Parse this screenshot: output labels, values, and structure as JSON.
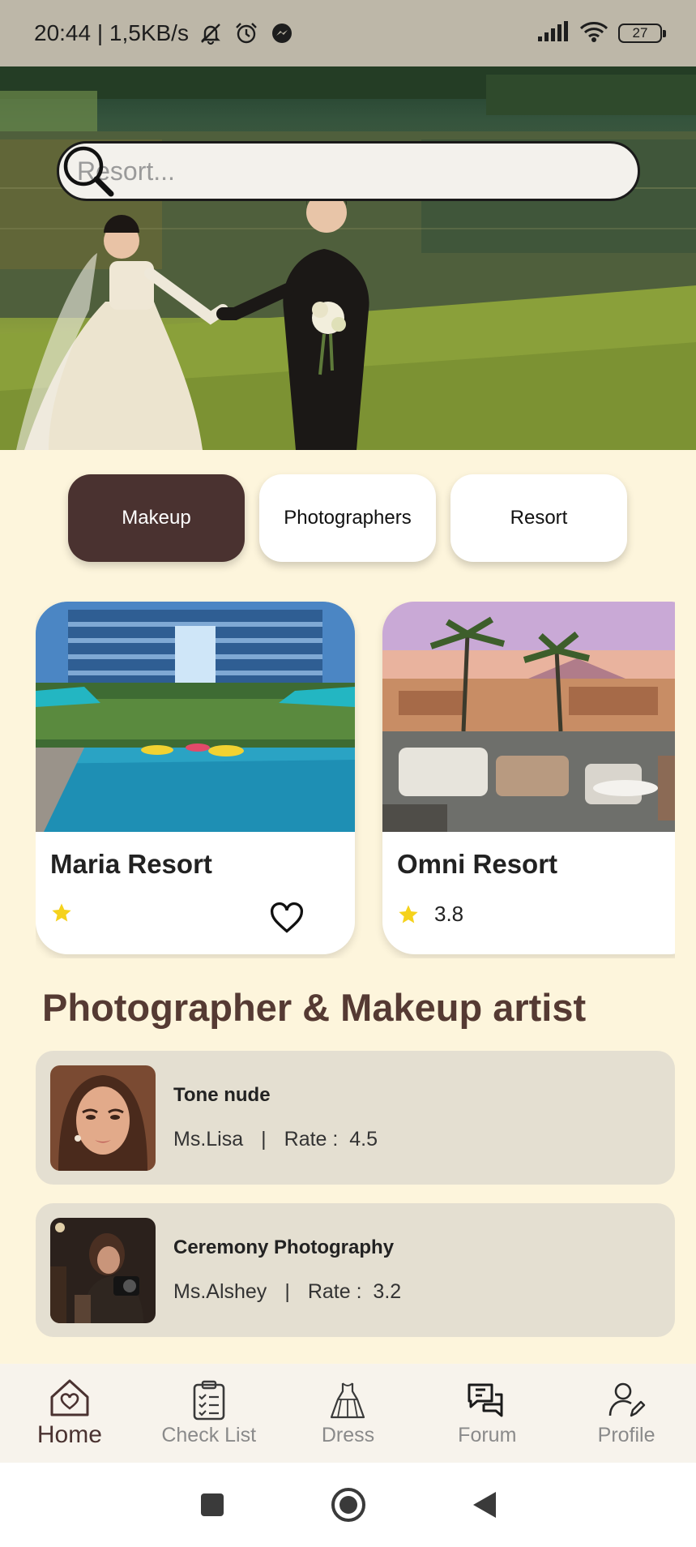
{
  "status_bar": {
    "time_speed": "20:44 | 1,5KB/s",
    "battery": "27"
  },
  "search": {
    "placeholder": "Resort..."
  },
  "categories": [
    {
      "label": "Makeup",
      "active": true
    },
    {
      "label": "Photographers",
      "active": false
    },
    {
      "label": "Resort",
      "active": false
    }
  ],
  "resorts": [
    {
      "name": "Maria Resort",
      "rating": ""
    },
    {
      "name": "Omni Resort",
      "rating": "3.8"
    }
  ],
  "section_title": "Photographer & Makeup artist",
  "artists": [
    {
      "service": "Tone nude",
      "name": "Ms.Lisa",
      "separator": "|",
      "rate_label": "Rate :",
      "rate": "4.5"
    },
    {
      "service": "Ceremony Photography",
      "name": "Ms.Alshey",
      "separator": "|",
      "rate_label": "Rate :",
      "rate": "3.2"
    }
  ],
  "bottom_nav": [
    {
      "label": "Home",
      "icon": "home-heart-icon",
      "active": true
    },
    {
      "label": "Check List",
      "icon": "clipboard-checklist-icon",
      "active": false
    },
    {
      "label": "Dress",
      "icon": "dress-icon",
      "active": false
    },
    {
      "label": "Forum",
      "icon": "chat-bubbles-icon",
      "active": false
    },
    {
      "label": "Profile",
      "icon": "user-edit-icon",
      "active": false
    }
  ],
  "colors": {
    "background": "#fdf5dc",
    "accent": "#4a3230",
    "section_title": "#553a33",
    "card_list_bg": "#e4dfd1",
    "star": "#f5d21c"
  }
}
